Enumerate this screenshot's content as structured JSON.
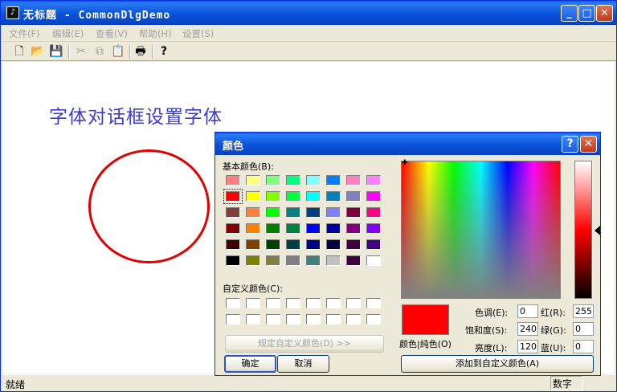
{
  "window": {
    "title": "无标题 - CommonDlgDemo",
    "app_icon": "♪",
    "minimize": "_",
    "maximize": "□",
    "close": "✕"
  },
  "menu": {
    "items": [
      "文件(F)",
      "编辑(E)",
      "查看(V)",
      "帮助(H)",
      "设置(S)"
    ]
  },
  "toolbar": {
    "new": "🗋",
    "open": "📂",
    "save": "💾",
    "cut": "✂",
    "copy": "⧉",
    "paste": "📋",
    "print": "🖶",
    "help": "?"
  },
  "content": {
    "heading": "字体对话框设置字体"
  },
  "status": {
    "text": "就绪",
    "num": "数字"
  },
  "dialog": {
    "title": "颜色",
    "help_btn": "?",
    "close_btn": "✕",
    "basic_colors_label": "基本颜色(B):",
    "custom_colors_label": "自定义颜色(C):",
    "define_custom_btn": "规定自定义颜色(D) >>",
    "ok_btn": "确定",
    "cancel_btn": "取消",
    "color_solid_label": "颜色|纯色(O)",
    "add_custom_btn": "添加到自定义颜色(A)",
    "hue_label": "色调(E):",
    "hue": "0",
    "sat_label": "饱和度(S):",
    "sat": "240",
    "lum_label": "亮度(L):",
    "lum": "120",
    "red_label": "红(R):",
    "red": "255",
    "green_label": "绿(G):",
    "green": "0",
    "blue_label": "蓝(U):",
    "blue": "0",
    "selected_color": "#ff0000",
    "basic_colors": [
      [
        "#ff8080",
        "#ffff80",
        "#80ff80",
        "#00ff80",
        "#80ffff",
        "#0080ff",
        "#ff80c0",
        "#ff80ff"
      ],
      [
        "#ff0000",
        "#ffff00",
        "#80ff00",
        "#00ff40",
        "#00ffff",
        "#0080c0",
        "#8080c0",
        "#ff00ff"
      ],
      [
        "#804040",
        "#ff8040",
        "#00ff00",
        "#008080",
        "#004080",
        "#8080ff",
        "#800040",
        "#ff0080"
      ],
      [
        "#800000",
        "#ff8000",
        "#008000",
        "#008040",
        "#0000ff",
        "#0000a0",
        "#800080",
        "#8000ff"
      ],
      [
        "#400000",
        "#804000",
        "#004000",
        "#004040",
        "#000080",
        "#000040",
        "#400040",
        "#400080"
      ],
      [
        "#000000",
        "#808000",
        "#808040",
        "#808080",
        "#408080",
        "#c0c0c0",
        "#400040",
        "#ffffff"
      ]
    ]
  }
}
